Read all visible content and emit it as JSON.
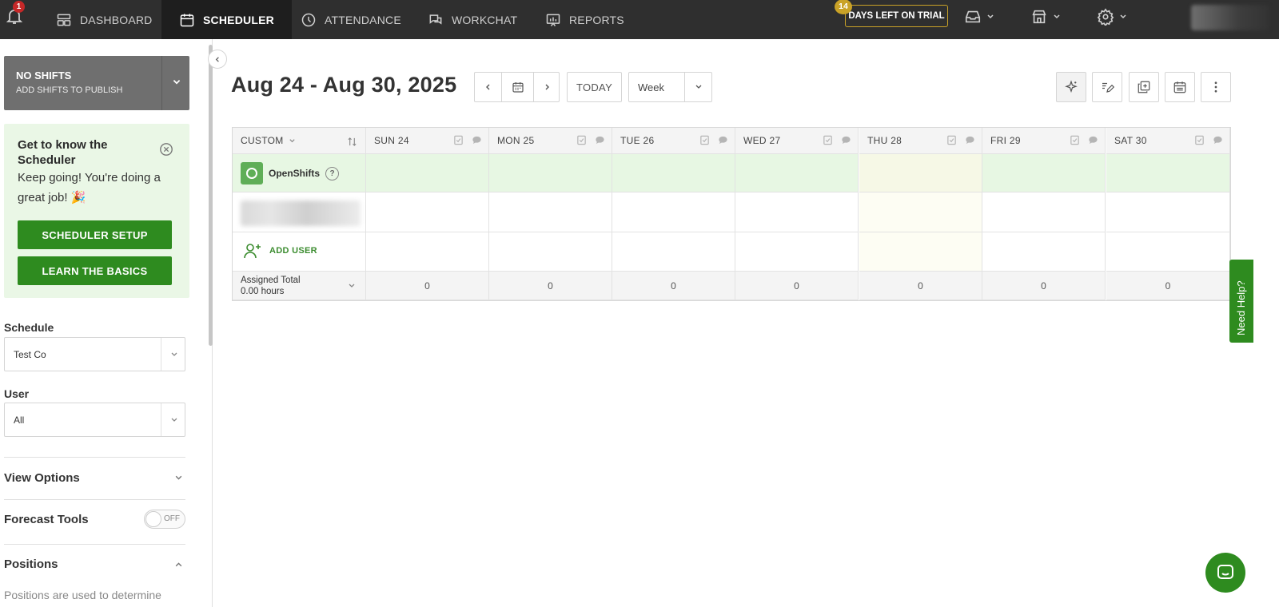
{
  "nav": {
    "notifications_count": "1",
    "items": [
      {
        "label": "DASHBOARD"
      },
      {
        "label": "SCHEDULER"
      },
      {
        "label": "ATTENDANCE"
      },
      {
        "label": "WORKCHAT"
      },
      {
        "label": "REPORTS"
      }
    ],
    "trial_days": "14",
    "trial_label": "DAYS LEFT ON TRIAL"
  },
  "sidebar": {
    "publish_title": "NO SHIFTS",
    "publish_sub": "ADD SHIFTS TO PUBLISH",
    "getknow_title": "Get to know the Scheduler",
    "getknow_msg": "Keep going! You're doing a great job! 🎉",
    "setup_btn": "SCHEDULER SETUP",
    "basics_btn": "LEARN THE BASICS",
    "schedule_label": "Schedule",
    "schedule_value": "Test Co",
    "user_label": "User",
    "user_value": "All",
    "view_options": "View Options",
    "forecast_tools": "Forecast Tools",
    "forecast_toggle": "OFF",
    "positions": "Positions",
    "positions_text": "Positions are used to determine"
  },
  "header": {
    "date_range": "Aug 24 - Aug 30, 2025",
    "today": "TODAY",
    "view": "Week"
  },
  "grid": {
    "first_col_label": "CUSTOM",
    "days": [
      "SUN 24",
      "MON 25",
      "TUE 26",
      "WED 27",
      "THU 28",
      "FRI 29",
      "SAT 30"
    ],
    "openshifts_label": "OpenShifts",
    "add_user": "ADD USER",
    "total_label": "Assigned Total",
    "total_hours": "0.00 hours",
    "totals": [
      "0",
      "0",
      "0",
      "0",
      "0",
      "0",
      "0"
    ]
  },
  "need_help": "Need Help?",
  "colors": {
    "nav_bg": "#2f2f2f",
    "accent_green": "#2e8b1f",
    "open_row": "#e7f7e3",
    "trial_gold": "#c9a227"
  }
}
